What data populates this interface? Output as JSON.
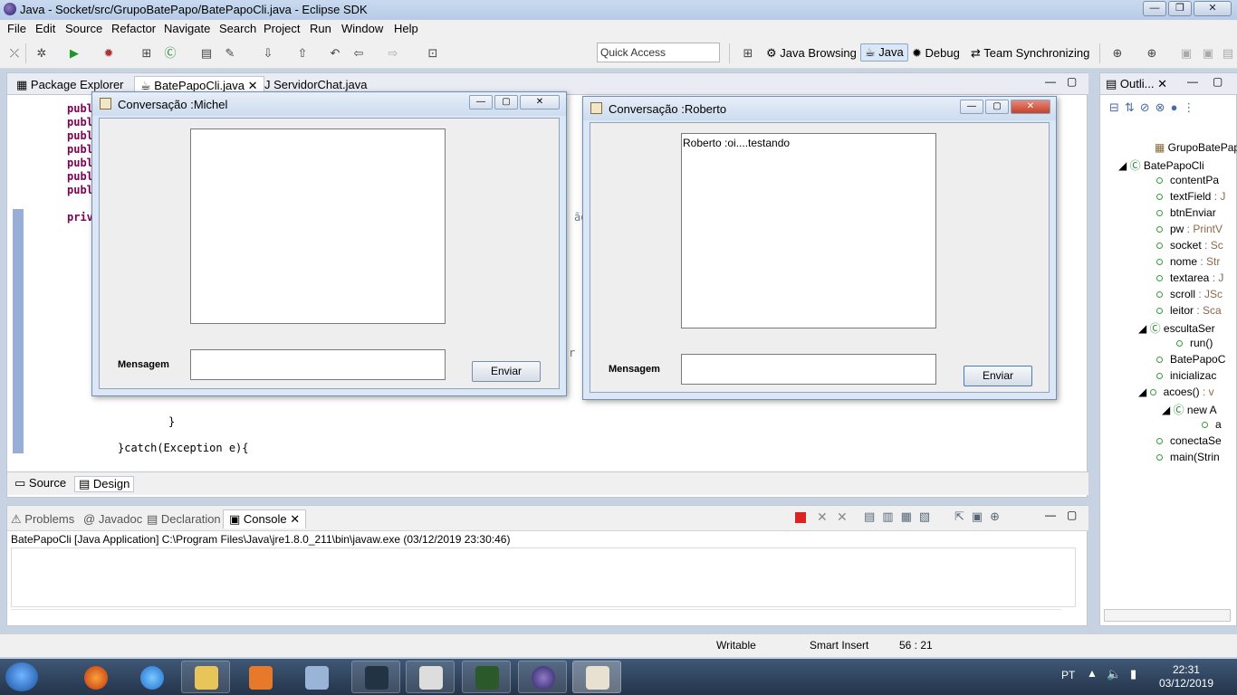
{
  "window": {
    "title": "Java - Socket/src/GrupoBatePapo/BatePapoCli.java - Eclipse SDK",
    "minimize_icon": "minimize-icon",
    "maximize_icon": "maximize-icon",
    "close_icon": "close-icon"
  },
  "menu": [
    "File",
    "Edit",
    "Source",
    "Refactor",
    "Navigate",
    "Search",
    "Project",
    "Run",
    "Window",
    "Help"
  ],
  "toolbar": {
    "quick_access": "Quick Access",
    "perspectives": [
      "Java Browsing",
      "Java",
      "Debug",
      "Team Synchronizing"
    ]
  },
  "editor": {
    "tabs": [
      "Package Explorer",
      "BatePapoCli.java",
      "ServidorChat.java"
    ],
    "code_lines": [
      "publ",
      "publ",
      "publ",
      "publ",
      "publ",
      "publ",
      "publ",
      "priv",
      "}",
      "}catch(Exception e){"
    ],
    "fragment_1": "ão",
    "fragment_2": "r",
    "bottom_tabs": [
      "Source",
      "Design"
    ]
  },
  "outline": {
    "title": "Outli...",
    "items": [
      {
        "label": "GrupoBatePapo",
        "type": ""
      },
      {
        "label": "BatePapoCli",
        "type": ""
      },
      {
        "label": "contentPa",
        "type": ""
      },
      {
        "label": "textField",
        "type": " : J"
      },
      {
        "label": "btnEnviar",
        "type": ""
      },
      {
        "label": "pw",
        "type": " : PrintV"
      },
      {
        "label": "socket",
        "type": " : Sc"
      },
      {
        "label": "nome",
        "type": " : Str"
      },
      {
        "label": "textarea",
        "type": " : J"
      },
      {
        "label": "scroll",
        "type": " : JSc"
      },
      {
        "label": "leitor",
        "type": " : Sca"
      },
      {
        "label": "escultaSer",
        "type": ""
      },
      {
        "label": "run()",
        "type": ""
      },
      {
        "label": "BatePapoC",
        "type": ""
      },
      {
        "label": "inicializac",
        "type": ""
      },
      {
        "label": "acoes()",
        "type": " : v"
      },
      {
        "label": "new A",
        "type": ""
      },
      {
        "label": "a",
        "type": ""
      },
      {
        "label": "conectaSe",
        "type": ""
      },
      {
        "label": "main(Strin",
        "type": ""
      }
    ]
  },
  "console": {
    "tabs": [
      "Problems",
      "Javadoc",
      "Declaration",
      "Console"
    ],
    "launch_line": "BatePapoCli [Java Application] C:\\Program Files\\Java\\jre1.8.0_211\\bin\\javaw.exe (03/12/2019 23:30:46)"
  },
  "statusbar": {
    "writable": "Writable",
    "insert_mode": "Smart Insert",
    "position": "56 : 21"
  },
  "chat_window_michel": {
    "title": "Conversação :Michel",
    "history": "",
    "message_label": "Mensagem",
    "message_value": "",
    "send_label": "Enviar"
  },
  "chat_window_roberto": {
    "title": "Conversação :Roberto",
    "history": "Roberto :oi....testando",
    "message_label": "Mensagem",
    "message_value": "",
    "send_label": "Enviar"
  },
  "taskbar": {
    "language": "PT",
    "time": "22:31",
    "date": "03/12/2019"
  }
}
